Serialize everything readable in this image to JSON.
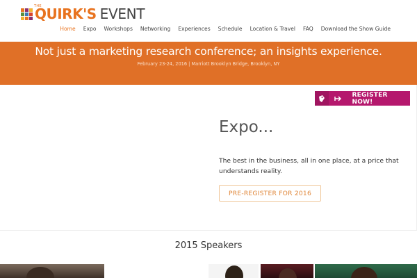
{
  "logo": {
    "the": "THE",
    "name": "QUIRK'S",
    "event": "EVENT"
  },
  "nav": {
    "items": [
      {
        "label": "Home",
        "active": true
      },
      {
        "label": "Expo"
      },
      {
        "label": "Workshops"
      },
      {
        "label": "Networking"
      },
      {
        "label": "Experiences"
      },
      {
        "label": "Schedule"
      },
      {
        "label": "Location & Travel"
      },
      {
        "label": "FAQ"
      },
      {
        "label": "Download the Show Guide"
      }
    ],
    "search_icon": "search-icon"
  },
  "banner": {
    "title": "Not just a marketing research conference; an insights experience.",
    "subtitle": "February 23-24, 2016 | Marriott Brooklyn Bridge, Brooklyn, NY",
    "color": "#e07027"
  },
  "register": {
    "label": "REGISTER NOW!",
    "color": "#b5186d"
  },
  "expo": {
    "title": "Expo...",
    "description": "The best in the business, all in one place, at a price that understands reality.",
    "button": "PRE-REGISTER FOR 2016"
  },
  "speakers": {
    "title": "2015 Speakers"
  },
  "colors": {
    "accent": "#e8731f"
  }
}
